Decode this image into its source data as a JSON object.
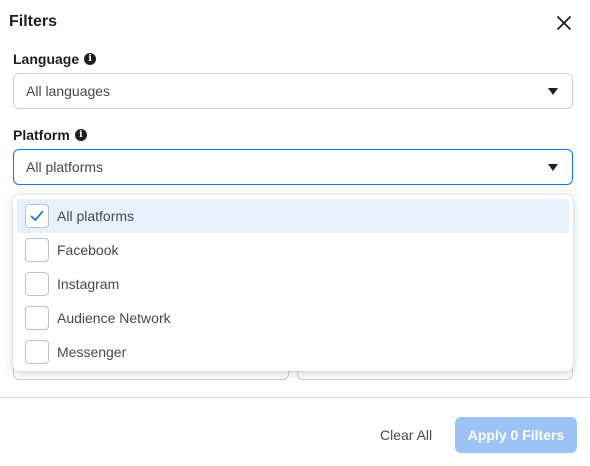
{
  "dialog": {
    "title": "Filters"
  },
  "language": {
    "label": "Language",
    "value": "All languages"
  },
  "platform": {
    "label": "Platform",
    "value": "All platforms",
    "options": [
      {
        "label": "All platforms",
        "checked": true
      },
      {
        "label": "Facebook",
        "checked": false
      },
      {
        "label": "Instagram",
        "checked": false
      },
      {
        "label": "Audience Network",
        "checked": false
      },
      {
        "label": "Messenger",
        "checked": false
      }
    ]
  },
  "footer": {
    "clear_label": "Clear All",
    "apply_label": "Apply 0 Filters"
  },
  "colors": {
    "accent": "#1877f2",
    "apply_disabled": "#9cc3f6",
    "selected_bg": "#e7f0fb"
  },
  "icons": {
    "close": "close-icon",
    "info": "info-icon",
    "caret": "caret-down-icon",
    "check": "checkmark-icon"
  }
}
